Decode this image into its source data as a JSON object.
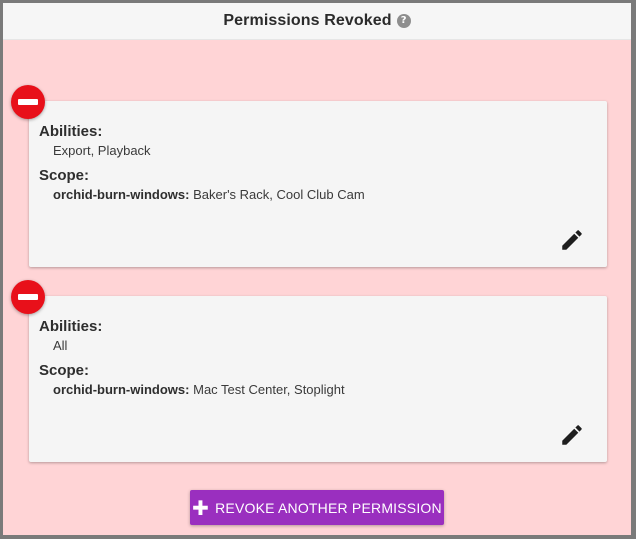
{
  "header": {
    "title": "Permissions Revoked",
    "help_icon": "?"
  },
  "permissions": [
    {
      "abilities_label": "Abilities:",
      "abilities": "Export, Playback",
      "scope_label": "Scope:",
      "scope_project": "orchid-burn-windows:",
      "scope_items": "Baker's Rack, Cool Club Cam"
    },
    {
      "abilities_label": "Abilities:",
      "abilities": "All",
      "scope_label": "Scope:",
      "scope_project": "orchid-burn-windows:",
      "scope_items": "Mac Test Center, Stoplight"
    }
  ],
  "actions": {
    "revoke_another_label": "REVOKE ANOTHER PERMISSION",
    "plus_icon": "✚"
  },
  "colors": {
    "background": "#ffd4d6",
    "remove": "#e8101a",
    "primary_button": "#9a2fbf"
  }
}
